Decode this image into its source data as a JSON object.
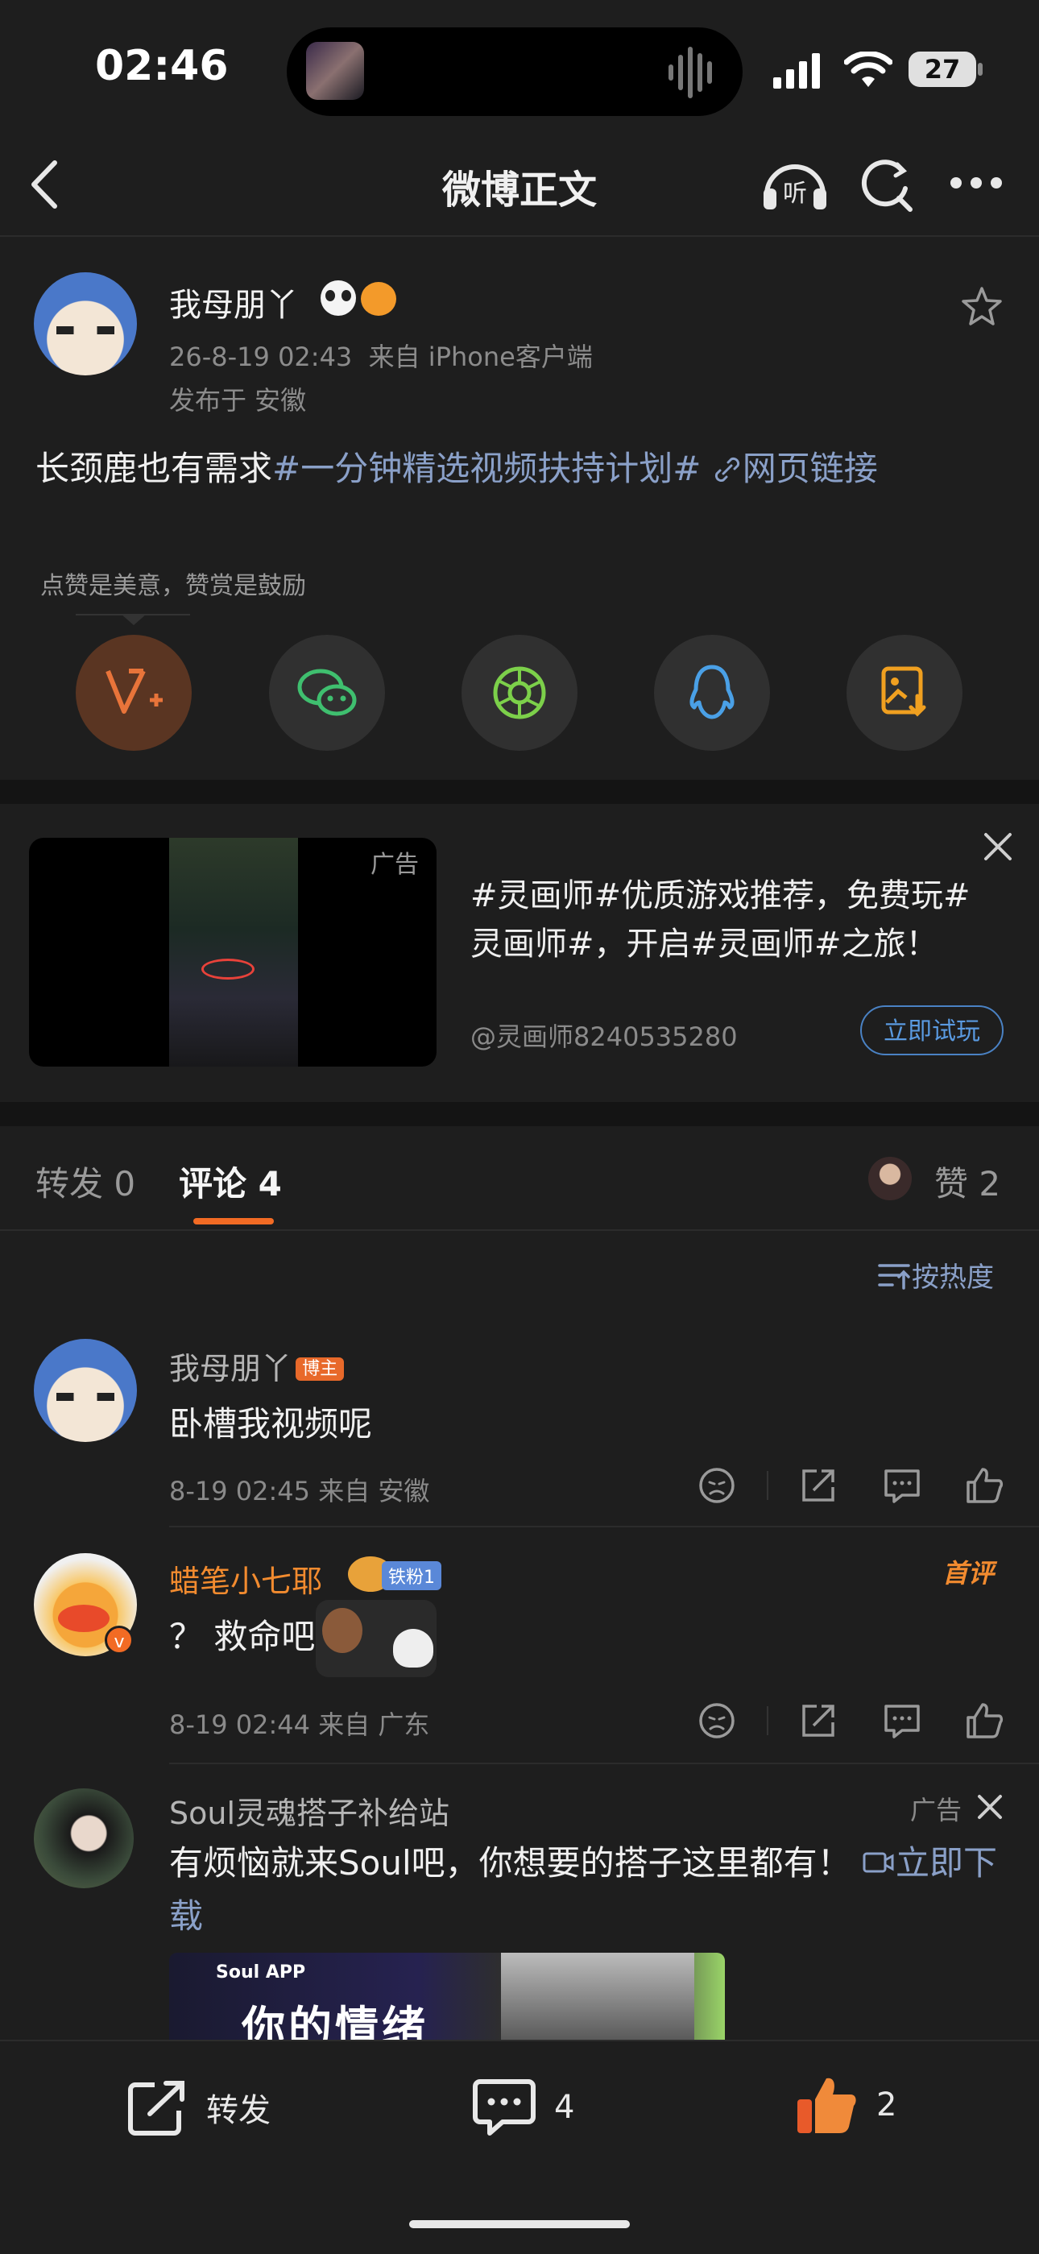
{
  "status": {
    "time": "02:46",
    "battery": "27"
  },
  "nav": {
    "title": "微博正文"
  },
  "post": {
    "author": "我母朋丫",
    "timestamp": "26-8-19 02:43",
    "source": "来自 iPhone客户端",
    "location": "发布于 安徽",
    "text_plain": "长颈鹿也有需求",
    "topic": "#一分钟精选视频扶持计划#",
    "link_label": "网页链接"
  },
  "reward": {
    "hint": "点赞是美意，赞赏是鼓励"
  },
  "ad": {
    "video_label": "广告",
    "text": "#灵画师#优质游戏推荐，免费玩#灵画师#，开启#灵画师#之旅！",
    "source": "@灵画师8240535280",
    "cta": "立即试玩"
  },
  "tabs": {
    "repost": "转发 0",
    "comment": "评论 4",
    "like": "赞 2",
    "sort": "按热度"
  },
  "comments": [
    {
      "name": "我母朋丫",
      "badge": "博主",
      "text": "卧槽我视频呢",
      "meta": "8-19 02:45 来自 安徽"
    },
    {
      "name": "蜡笔小七耶",
      "badge": "铁粉1",
      "text": "？ 救命吧",
      "meta": "8-19 02:44 来自 广东",
      "first_label": "首评"
    }
  ],
  "ad_comment": {
    "name": "Soul灵魂搭子补给站",
    "label": "广告",
    "text": "有烦恼就来Soul吧，你想要的搭子这里都有！",
    "cta": "立即下载",
    "banner_brand": "Soul APP",
    "banner_text": "你的情绪"
  },
  "bottom": {
    "repost": "转发",
    "comment_count": "4",
    "like_count": "2"
  },
  "colors": {
    "accent": "#f26b24",
    "link": "#8aa0c8",
    "background": "#1e1e1e",
    "wechat": "#3fbf6f",
    "qq": "#4aa0e6",
    "save": "#f0a020"
  }
}
